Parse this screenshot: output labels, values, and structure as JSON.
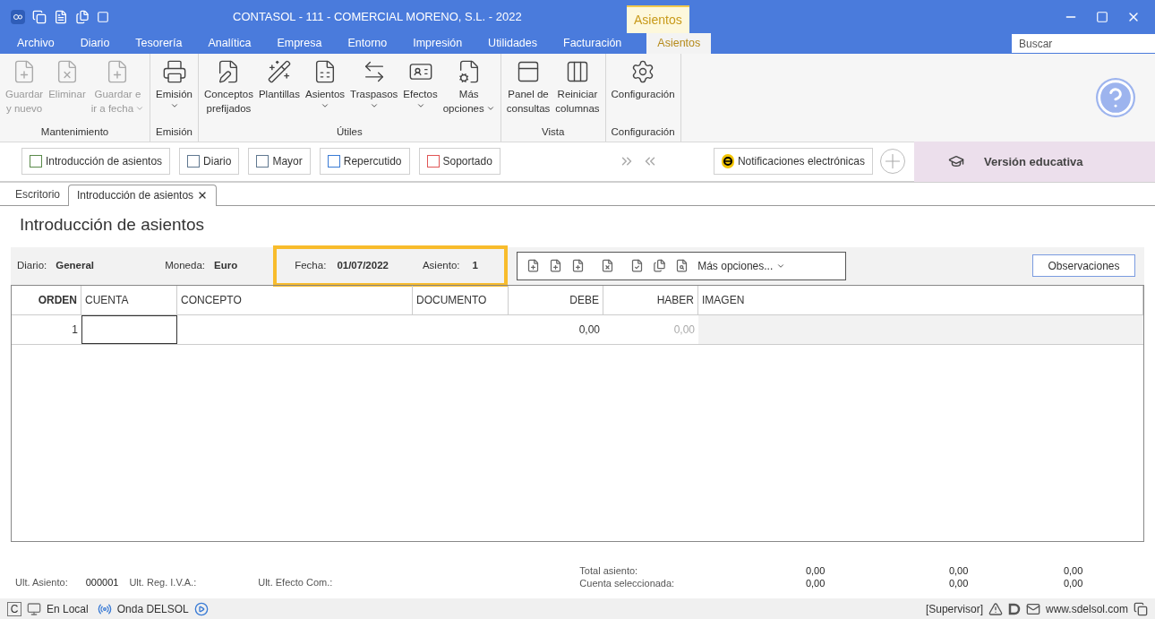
{
  "window": {
    "title": "CONTASOL - 111 - COMERCIAL MORENO, S.L. - 2022",
    "context_tab": "Asientos"
  },
  "menu": [
    {
      "label": "Archivo",
      "selected": false
    },
    {
      "label": "Diario",
      "selected": false
    },
    {
      "label": "Tesorería",
      "selected": false
    },
    {
      "label": "Analítica",
      "selected": false
    },
    {
      "label": "Empresa",
      "selected": false
    },
    {
      "label": "Entorno",
      "selected": false
    },
    {
      "label": "Impresión",
      "selected": false
    },
    {
      "label": "Utilidades",
      "selected": false
    },
    {
      "label": "Facturación",
      "selected": false
    },
    {
      "label": "Asientos",
      "selected": true
    }
  ],
  "search": {
    "placeholder": "Buscar"
  },
  "ribbon": [
    {
      "label": "Mantenimiento",
      "buttons": [
        {
          "lines": [
            "Guardar",
            "y nuevo"
          ],
          "disabled": true,
          "dropdown": false
        },
        {
          "lines": [
            "Eliminar"
          ],
          "disabled": true,
          "dropdown": false
        },
        {
          "lines": [
            "Guardar e",
            "ir a fecha"
          ],
          "disabled": true,
          "dropdown": true
        }
      ]
    },
    {
      "label": "Emisión",
      "buttons": [
        {
          "lines": [
            "Emisión"
          ],
          "disabled": false,
          "dropdown": true
        }
      ]
    },
    {
      "label": "Útiles",
      "buttons": [
        {
          "lines": [
            "Conceptos",
            "prefijados"
          ],
          "disabled": false,
          "dropdown": false
        },
        {
          "lines": [
            "Plantillas"
          ],
          "disabled": false,
          "dropdown": false
        },
        {
          "lines": [
            "Asientos"
          ],
          "disabled": false,
          "dropdown": true
        },
        {
          "lines": [
            "Traspasos"
          ],
          "disabled": false,
          "dropdown": true
        },
        {
          "lines": [
            "Efectos"
          ],
          "disabled": false,
          "dropdown": true
        },
        {
          "lines": [
            "Más",
            "opciones"
          ],
          "disabled": false,
          "dropdown": true
        }
      ]
    },
    {
      "label": "Vista",
      "buttons": [
        {
          "lines": [
            "Panel de",
            "consultas"
          ],
          "disabled": false,
          "dropdown": false
        },
        {
          "lines": [
            "Reiniciar",
            "columnas"
          ],
          "disabled": false,
          "dropdown": false
        }
      ]
    },
    {
      "label": "Configuración",
      "buttons": [
        {
          "lines": [
            "Configuración"
          ],
          "disabled": false,
          "dropdown": false
        }
      ]
    }
  ],
  "shortcuts": [
    "Introducción de asientos",
    "Diario",
    "Mayor",
    "Repercutido",
    "Soportado"
  ],
  "notifications": "Notificaciones electrónicas",
  "edition": "Versión educativa",
  "doc_tabs": [
    {
      "label": "Escritorio",
      "selected": false,
      "closable": false
    },
    {
      "label": "Introducción de asientos",
      "selected": true,
      "closable": true
    }
  ],
  "page_title": "Introducción de asientos",
  "info": {
    "diario_label": "Diario:",
    "diario": "General",
    "moneda_label": "Moneda:",
    "moneda": "Euro",
    "fecha_label": "Fecha:",
    "fecha": "01/07/2022",
    "asiento_label": "Asiento:",
    "asiento": "1",
    "highlighted": true
  },
  "more_options": "Más opciones...",
  "observations": "Observaciones",
  "table": {
    "columns": [
      "ORDEN",
      "CUENTA",
      "CONCEPTO",
      "DOCUMENTO",
      "DEBE",
      "HABER",
      "IMAGEN"
    ],
    "rows": [
      {
        "orden": "1",
        "debe": "0,00",
        "haber": "0,00"
      }
    ]
  },
  "footer": {
    "ult_asiento_label": "Ult. Asiento:",
    "ult_asiento": "000001",
    "ult_iva_label": "Ult. Reg. I.V.A.:",
    "ult_efecto_label": "Ult. Efecto Com.:",
    "totals": [
      {
        "label": "Total asiento:",
        "values": [
          "0,00",
          "0,00",
          "0,00"
        ]
      },
      {
        "label": "Cuenta seleccionada:",
        "values": [
          "0,00",
          "0,00",
          "0,00"
        ]
      }
    ]
  },
  "status": {
    "mode_letter": "C",
    "location": "En Local",
    "radio": "Onda DELSOL",
    "user": "[Supervisor]",
    "website": "www.sdelsol.com"
  }
}
